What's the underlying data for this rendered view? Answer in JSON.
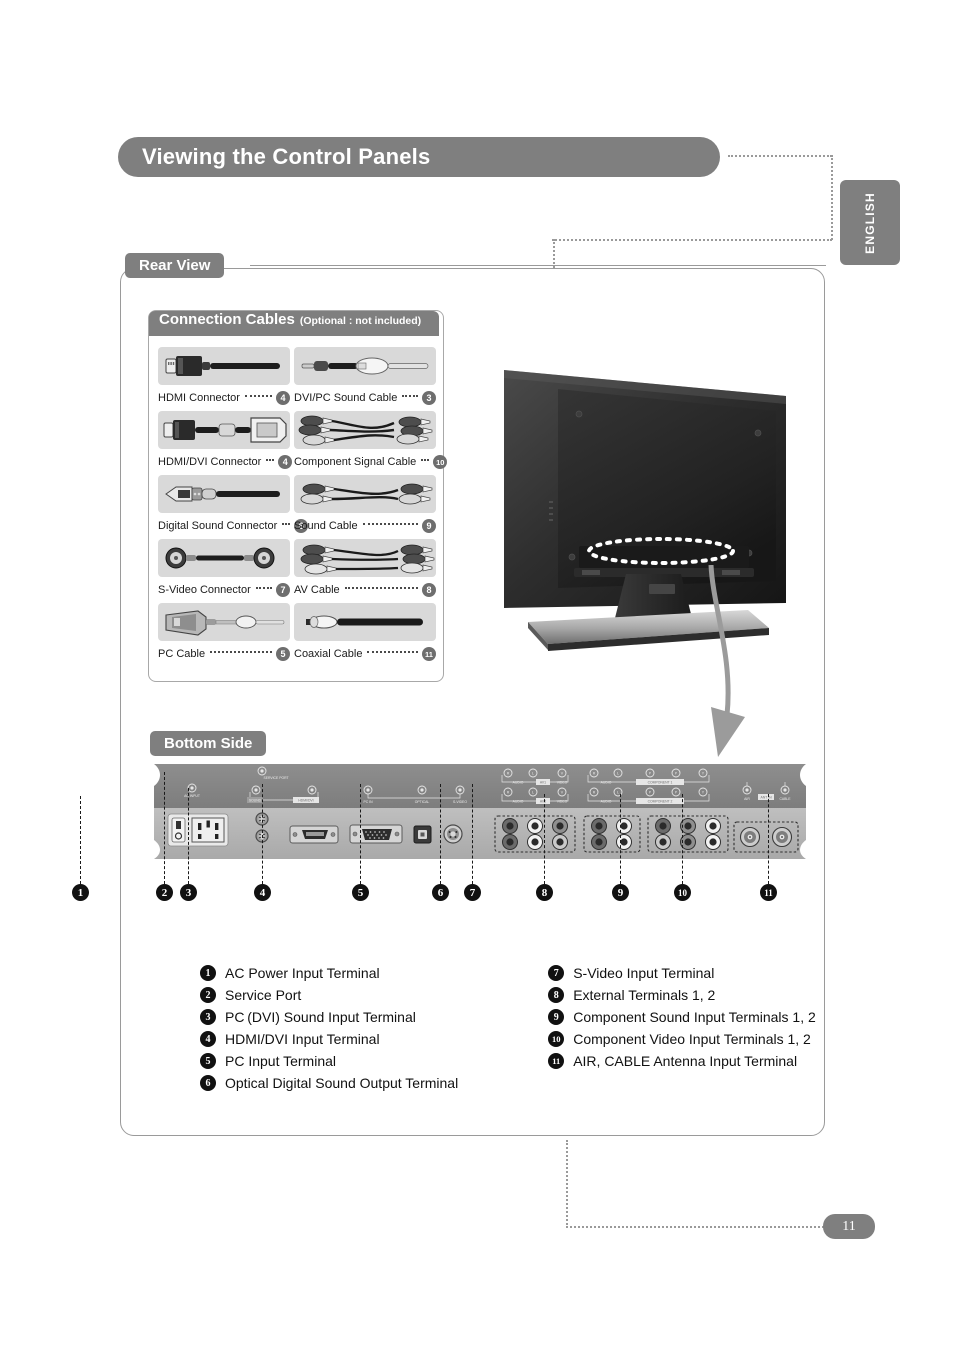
{
  "header": {
    "title": "Viewing the Control Panels",
    "language_tab": "ENGLISH"
  },
  "sections": {
    "rear_view": "Rear View",
    "bottom_side": "Bottom Side"
  },
  "cables_box": {
    "title": "Connection Cables",
    "subtitle": "(Optional : not included)",
    "items": [
      {
        "label": "HDMI Connector",
        "ref": "4",
        "icon": "hdmi-connector-icon"
      },
      {
        "label": "DVI/PC Sound Cable",
        "ref": "3",
        "icon": "dvi-pc-sound-cable-icon"
      },
      {
        "label": "HDMI/DVI Connector",
        "ref": "4",
        "icon": "hdmi-dvi-connector-icon"
      },
      {
        "label": "Component Signal Cable",
        "ref": "10",
        "icon": "component-signal-cable-icon"
      },
      {
        "label": "Digital Sound Connector",
        "ref": "6",
        "icon": "digital-sound-connector-icon"
      },
      {
        "label": "Sound Cable",
        "ref": "9",
        "icon": "sound-cable-icon"
      },
      {
        "label": "S-Video Connector",
        "ref": "7",
        "icon": "s-video-connector-icon"
      },
      {
        "label": "AV Cable",
        "ref": "8",
        "icon": "av-cable-icon"
      },
      {
        "label": "PC Cable",
        "ref": "5",
        "icon": "pc-cable-icon"
      },
      {
        "label": "Coaxial Cable",
        "ref": "11",
        "icon": "coaxial-cable-icon"
      }
    ]
  },
  "panel_port_labels": {
    "ac_input": "AC INPUT",
    "service_port": "SERVICE PORT",
    "sound": "SOUND",
    "hdmi_dvi": "HDMI/DVI",
    "pc_in": "PC IN",
    "optical": "OPTICAL",
    "s_video": "S-VIDEO",
    "audio": "AUDIO",
    "video": "VIDEO",
    "av1": "AV1",
    "av2": "AV2",
    "component1": "COMPONENT 1",
    "component2": "COMPONENT 2",
    "air": "AIR",
    "cable": "CABLE",
    "antenna": "ANT IN",
    "jack_r": "R",
    "jack_l": "L",
    "jack_pr": "PR",
    "jack_pb": "PB",
    "jack_y": "Y"
  },
  "callouts": [
    "1",
    "2",
    "3",
    "4",
    "5",
    "6",
    "7",
    "8",
    "9",
    "10",
    "11"
  ],
  "legend": {
    "left_column": [
      {
        "num": "1",
        "text": "AC Power Input Terminal"
      },
      {
        "num": "2",
        "text": "Service Port"
      },
      {
        "num": "3",
        "text": "PC (DVI) Sound Input Terminal"
      },
      {
        "num": "4",
        "text": "HDMI/DVI Input Terminal"
      },
      {
        "num": "5",
        "text": "PC Input Terminal"
      },
      {
        "num": "6",
        "text": "Optical Digital Sound Output Terminal"
      }
    ],
    "right_column": [
      {
        "num": "7",
        "text": "S-Video Input Terminal"
      },
      {
        "num": "8",
        "text": "External Terminals 1, 2"
      },
      {
        "num": "9",
        "text": "Component Sound Input Terminals 1, 2"
      },
      {
        "num": "10",
        "text": "Component Video Input Terminals 1, 2"
      },
      {
        "num": "11",
        "text": "AIR, CABLE Antenna Input Terminal"
      }
    ]
  },
  "footer": {
    "page_number": "11"
  },
  "colors": {
    "accent_gray": "#7f7f7f",
    "swatch_gray": "#d9d9d9",
    "panel_gray": "#9a9a9a",
    "ink": "#111111"
  }
}
